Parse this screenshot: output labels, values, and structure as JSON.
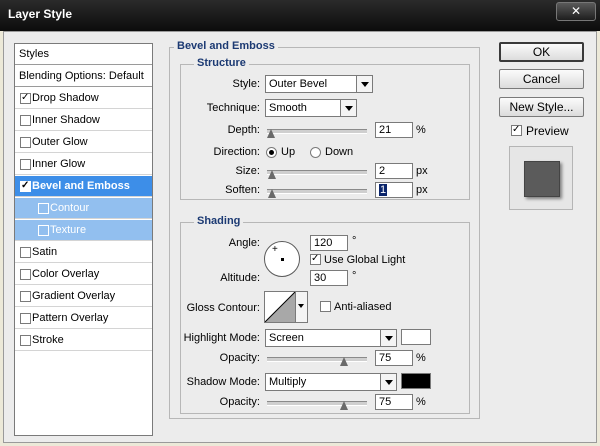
{
  "window": {
    "title": "Layer Style",
    "close_glyph": "✕"
  },
  "style_list": {
    "header": "Styles",
    "blending": "Blending Options: Default",
    "items": [
      {
        "label": "Drop Shadow",
        "checked": true
      },
      {
        "label": "Inner Shadow",
        "checked": false
      },
      {
        "label": "Outer Glow",
        "checked": false
      },
      {
        "label": "Inner Glow",
        "checked": false
      },
      {
        "label": "Bevel and Emboss",
        "checked": true,
        "active": true
      },
      {
        "label": "Contour",
        "checked": false,
        "sub": true
      },
      {
        "label": "Texture",
        "checked": false,
        "sub": true
      },
      {
        "label": "Satin",
        "checked": false
      },
      {
        "label": "Color Overlay",
        "checked": false
      },
      {
        "label": "Gradient Overlay",
        "checked": false
      },
      {
        "label": "Pattern Overlay",
        "checked": false
      },
      {
        "label": "Stroke",
        "checked": false
      }
    ]
  },
  "bevel": {
    "title": "Bevel and Emboss",
    "structure": {
      "title": "Structure",
      "style_label": "Style:",
      "style_value": "Outer Bevel",
      "technique_label": "Technique:",
      "technique_value": "Smooth",
      "depth_label": "Depth:",
      "depth_value": "21",
      "depth_unit": "%",
      "direction_label": "Direction:",
      "up_label": "Up",
      "down_label": "Down",
      "direction_selected": "Up",
      "size_label": "Size:",
      "size_value": "2",
      "size_unit": "px",
      "soften_label": "Soften:",
      "soften_value": "1",
      "soften_unit": "px"
    },
    "shading": {
      "title": "Shading",
      "angle_label": "Angle:",
      "angle_value": "120",
      "angle_unit": "°",
      "global_light_label": "Use Global Light",
      "global_light": true,
      "altitude_label": "Altitude:",
      "altitude_value": "30",
      "altitude_unit": "°",
      "gloss_label": "Gloss Contour:",
      "anti_aliased_label": "Anti-aliased",
      "anti_aliased": false,
      "highlight_mode_label": "Highlight Mode:",
      "highlight_mode": "Screen",
      "highlight_color": "#ffffff",
      "highlight_opacity_label": "Opacity:",
      "highlight_opacity": "75",
      "highlight_opacity_unit": "%",
      "shadow_mode_label": "Shadow Mode:",
      "shadow_mode": "Multiply",
      "shadow_color": "#000000",
      "shadow_opacity_label": "Opacity:",
      "shadow_opacity": "75",
      "shadow_opacity_unit": "%"
    }
  },
  "buttons": {
    "ok": "OK",
    "cancel": "Cancel",
    "new_style": "New Style..."
  },
  "preview": {
    "label": "Preview",
    "checked": true
  }
}
